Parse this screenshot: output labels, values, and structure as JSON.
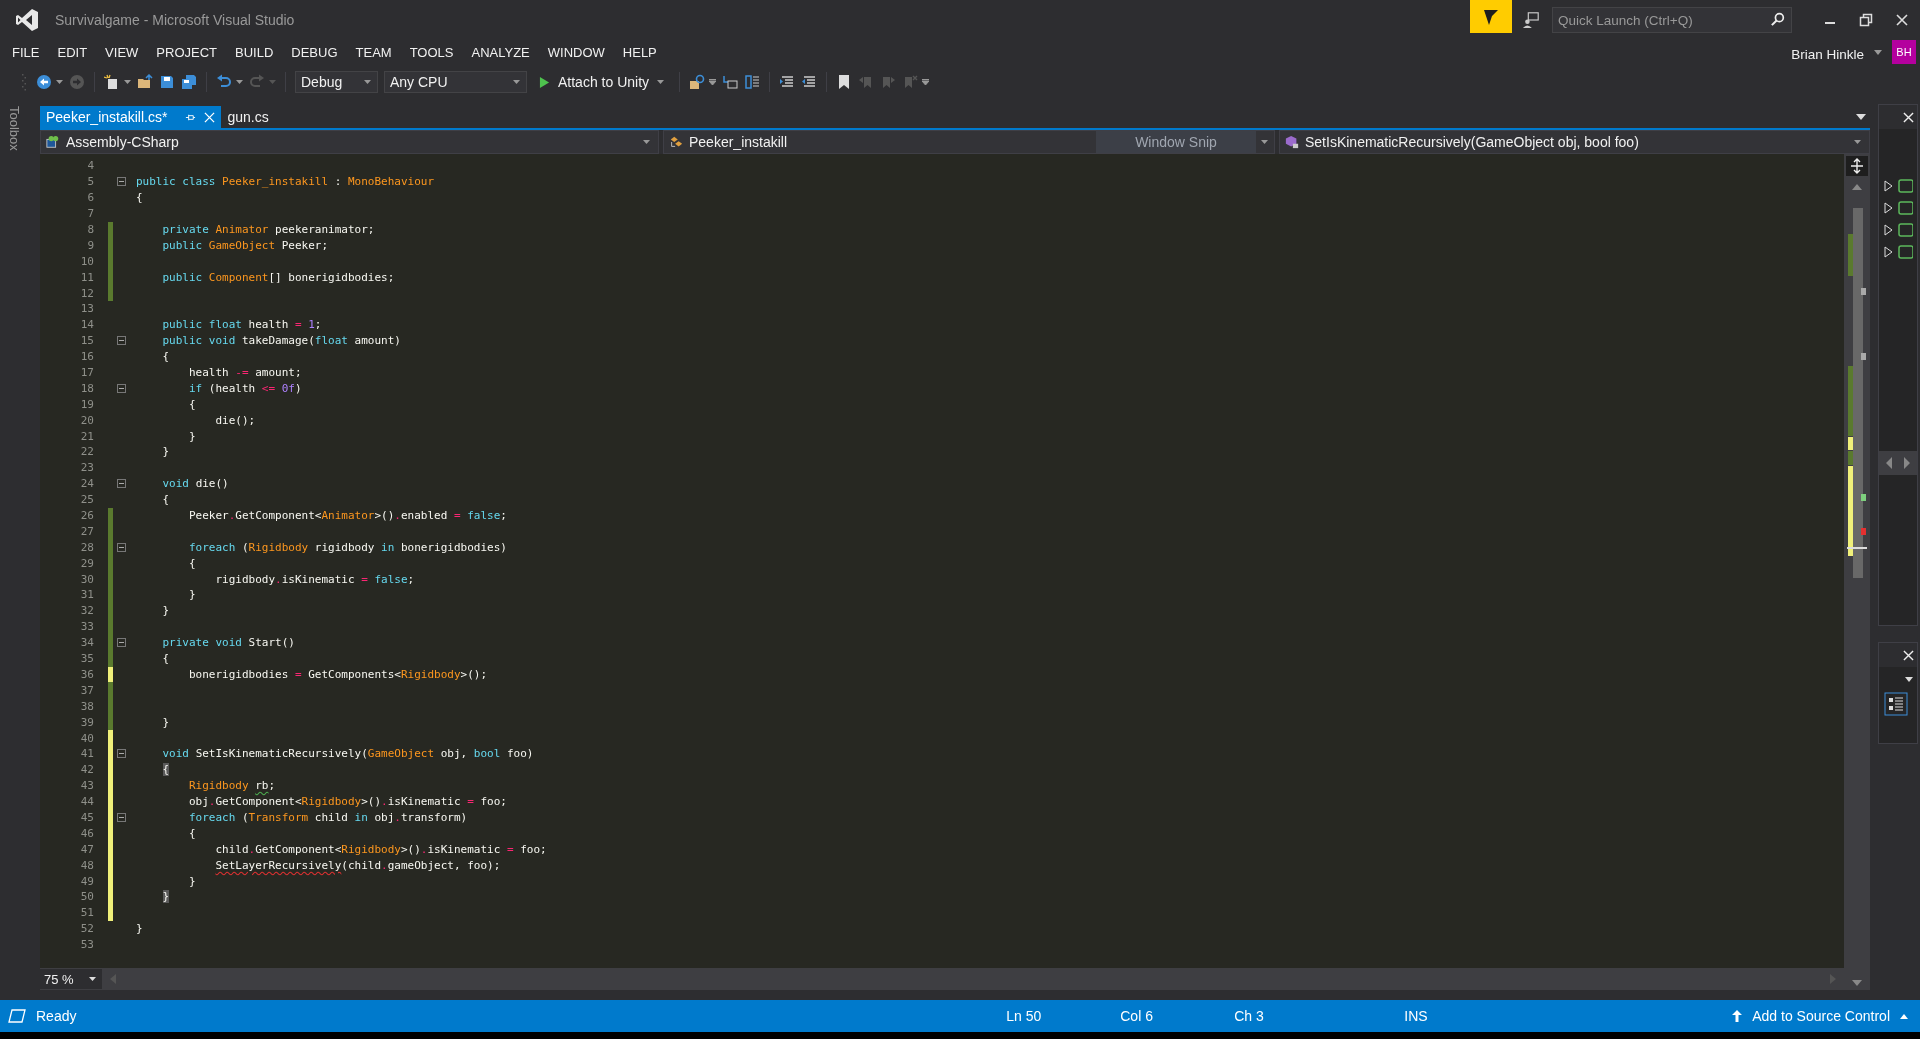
{
  "window": {
    "title": "Survivalgame - Microsoft Visual Studio",
    "quick_launch": {
      "placeholder": "Quick Launch (Ctrl+Q)"
    },
    "user": {
      "name": "Brian Hinkle",
      "initials": "BH"
    }
  },
  "menu": [
    "FILE",
    "EDIT",
    "VIEW",
    "PROJECT",
    "BUILD",
    "DEBUG",
    "TEAM",
    "TOOLS",
    "ANALYZE",
    "WINDOW",
    "HELP"
  ],
  "toolbar": {
    "configuration": "Debug",
    "platform": "Any CPU",
    "run_button": "Attach to Unity"
  },
  "side_tab": "Toolbox",
  "tabs": [
    {
      "label": "Peeker_instakill.cs*",
      "selected": true
    },
    {
      "label": "gun.cs",
      "selected": false
    }
  ],
  "navigation_bar": {
    "project": "Assembly-CSharp",
    "class": "Peeker_instakill",
    "overlay": "Window Snip",
    "member": "SetIsKinematicRecursively(GameObject obj, bool foo)"
  },
  "code_lines": [
    {
      "number": "4"
    },
    {
      "number": "5",
      "fold": true,
      "tokens": [
        {
          "kind": "kw",
          "text": "public class "
        },
        {
          "kind": "type",
          "text": "Peeker_instakill"
        },
        {
          "kind": "plain",
          "text": " : "
        },
        {
          "kind": "type",
          "text": "MonoBehaviour"
        }
      ]
    },
    {
      "number": "6",
      "tokens": [
        {
          "kind": "plain",
          "text": "{"
        }
      ]
    },
    {
      "number": "7"
    },
    {
      "number": "8",
      "color": "#5a7a2e",
      "tokens": [
        {
          "kind": "kw",
          "text": "    private "
        },
        {
          "kind": "type",
          "text": "Animator"
        },
        {
          "kind": "plain",
          "text": " peekeranimator;"
        }
      ]
    },
    {
      "number": "9",
      "color": "#5a7a2e",
      "tokens": [
        {
          "kind": "kw",
          "text": "    public "
        },
        {
          "kind": "type",
          "text": "GameObject"
        },
        {
          "kind": "plain",
          "text": " Peeker;"
        }
      ]
    },
    {
      "number": "10",
      "color": "#5a7a2e"
    },
    {
      "number": "11",
      "color": "#5a7a2e",
      "tokens": [
        {
          "kind": "kw",
          "text": "    public "
        },
        {
          "kind": "type",
          "text": "Component"
        },
        {
          "kind": "plain",
          "text": "[] bonerigidbodies;"
        }
      ]
    },
    {
      "number": "12",
      "color": "#5a7a2e"
    },
    {
      "number": "13"
    },
    {
      "number": "14",
      "tokens": [
        {
          "kind": "kw",
          "text": "    public float"
        },
        {
          "kind": "plain",
          "text": " health "
        },
        {
          "kind": "op",
          "text": "="
        },
        {
          "kind": "num",
          "text": " 1"
        },
        {
          "kind": "plain",
          "text": ";"
        }
      ]
    },
    {
      "number": "15",
      "fold": true,
      "tokens": [
        {
          "kind": "kw",
          "text": "    public void"
        },
        {
          "kind": "plain",
          "text": " takeDamage("
        },
        {
          "kind": "kw",
          "text": "float"
        },
        {
          "kind": "plain",
          "text": " amount)"
        }
      ]
    },
    {
      "number": "16",
      "tokens": [
        {
          "kind": "plain",
          "text": "    {"
        }
      ]
    },
    {
      "number": "17",
      "tokens": [
        {
          "kind": "plain",
          "text": "        health "
        },
        {
          "kind": "op",
          "text": "-="
        },
        {
          "kind": "plain",
          "text": " amount;"
        }
      ]
    },
    {
      "number": "18",
      "fold": true,
      "tokens": [
        {
          "kind": "kw",
          "text": "        if"
        },
        {
          "kind": "plain",
          "text": " (health "
        },
        {
          "kind": "op",
          "text": "<="
        },
        {
          "kind": "num",
          "text": " 0f"
        },
        {
          "kind": "plain",
          "text": ")"
        }
      ]
    },
    {
      "number": "19",
      "tokens": [
        {
          "kind": "plain",
          "text": "        {"
        }
      ]
    },
    {
      "number": "20",
      "tokens": [
        {
          "kind": "plain",
          "text": "            die();"
        }
      ]
    },
    {
      "number": "21",
      "tokens": [
        {
          "kind": "plain",
          "text": "        }"
        }
      ]
    },
    {
      "number": "22",
      "tokens": [
        {
          "kind": "plain",
          "text": "    }"
        }
      ]
    },
    {
      "number": "23"
    },
    {
      "number": "24",
      "fold": true,
      "tokens": [
        {
          "kind": "kw",
          "text": "    void"
        },
        {
          "kind": "plain",
          "text": " die()"
        }
      ]
    },
    {
      "number": "25",
      "tokens": [
        {
          "kind": "plain",
          "text": "    {"
        }
      ]
    },
    {
      "number": "26",
      "color": "#5a7a2e",
      "tokens": [
        {
          "kind": "plain",
          "text": "        Peeker"
        },
        {
          "kind": "op",
          "text": "."
        },
        {
          "kind": "plain",
          "text": "GetComponent<"
        },
        {
          "kind": "type",
          "text": "Animator"
        },
        {
          "kind": "plain",
          "text": ">()"
        },
        {
          "kind": "op",
          "text": "."
        },
        {
          "kind": "plain",
          "text": "enabled "
        },
        {
          "kind": "op",
          "text": "="
        },
        {
          "kind": "kw",
          "text": " false"
        },
        {
          "kind": "plain",
          "text": ";"
        }
      ]
    },
    {
      "number": "27",
      "color": "#5a7a2e"
    },
    {
      "number": "28",
      "color": "#5a7a2e",
      "fold": true,
      "tokens": [
        {
          "kind": "kw",
          "text": "        foreach"
        },
        {
          "kind": "plain",
          "text": " ("
        },
        {
          "kind": "type",
          "text": "Rigidbody"
        },
        {
          "kind": "plain",
          "text": " rigidbody "
        },
        {
          "kind": "kw",
          "text": "in"
        },
        {
          "kind": "plain",
          "text": " bonerigidbodies)"
        }
      ]
    },
    {
      "number": "29",
      "color": "#5a7a2e",
      "tokens": [
        {
          "kind": "plain",
          "text": "        {"
        }
      ]
    },
    {
      "number": "30",
      "color": "#5a7a2e",
      "tokens": [
        {
          "kind": "plain",
          "text": "            rigidbody"
        },
        {
          "kind": "op",
          "text": "."
        },
        {
          "kind": "plain",
          "text": "isKinematic "
        },
        {
          "kind": "op",
          "text": "="
        },
        {
          "kind": "kw",
          "text": " false"
        },
        {
          "kind": "plain",
          "text": ";"
        }
      ]
    },
    {
      "number": "31",
      "color": "#5a7a2e",
      "tokens": [
        {
          "kind": "plain",
          "text": "        }"
        }
      ]
    },
    {
      "number": "32",
      "color": "#5a7a2e",
      "tokens": [
        {
          "kind": "plain",
          "text": "    }"
        }
      ]
    },
    {
      "number": "33",
      "color": "#5a7a2e"
    },
    {
      "number": "34",
      "color": "#5a7a2e",
      "fold": true,
      "tokens": [
        {
          "kind": "kw",
          "text": "    private void"
        },
        {
          "kind": "plain",
          "text": " Start()"
        }
      ]
    },
    {
      "number": "35",
      "color": "#5a7a2e",
      "tokens": [
        {
          "kind": "plain",
          "text": "    {"
        }
      ]
    },
    {
      "number": "36",
      "color": "#f0f07a",
      "tokens": [
        {
          "kind": "plain",
          "text": "        bonerigidbodies "
        },
        {
          "kind": "op",
          "text": "="
        },
        {
          "kind": "plain",
          "text": " GetComponents<"
        },
        {
          "kind": "type",
          "text": "Rigidbody"
        },
        {
          "kind": "plain",
          "text": ">();"
        }
      ]
    },
    {
      "number": "37",
      "color": "#5a7a2e"
    },
    {
      "number": "38",
      "color": "#5a7a2e"
    },
    {
      "number": "39",
      "color": "#5a7a2e",
      "tokens": [
        {
          "kind": "plain",
          "text": "    }"
        }
      ]
    },
    {
      "number": "40",
      "color": "#f0f07a"
    },
    {
      "number": "41",
      "color": "#f0f07a",
      "fold": true,
      "tokens": [
        {
          "kind": "kw",
          "text": "    void"
        },
        {
          "kind": "plain",
          "text": " SetIsKinematicRecursively("
        },
        {
          "kind": "type",
          "text": "GameObject"
        },
        {
          "kind": "plain",
          "text": " obj, "
        },
        {
          "kind": "kw",
          "text": "bool"
        },
        {
          "kind": "plain",
          "text": " foo)"
        }
      ]
    },
    {
      "number": "42",
      "color": "#f0f07a",
      "tokens": [
        {
          "kind": "plain",
          "text": "    {",
          "highlighted": true
        }
      ]
    },
    {
      "number": "43",
      "color": "#f0f07a",
      "tokens": [
        {
          "kind": "type",
          "text": "        Rigidbody"
        },
        {
          "kind": "plain",
          "text": " rb",
          "warning": true
        },
        {
          "kind": "plain",
          "text": ";"
        }
      ]
    },
    {
      "number": "44",
      "color": "#f0f07a",
      "tokens": [
        {
          "kind": "plain",
          "text": "        obj"
        },
        {
          "kind": "op",
          "text": "."
        },
        {
          "kind": "plain",
          "text": "GetComponent<"
        },
        {
          "kind": "type",
          "text": "Rigidbody"
        },
        {
          "kind": "plain",
          "text": ">()"
        },
        {
          "kind": "op",
          "text": "."
        },
        {
          "kind": "plain",
          "text": "isKinematic "
        },
        {
          "kind": "op",
          "text": "="
        },
        {
          "kind": "plain",
          "text": " foo;"
        }
      ]
    },
    {
      "number": "45",
      "color": "#f0f07a",
      "fold": true,
      "tokens": [
        {
          "kind": "kw",
          "text": "        foreach"
        },
        {
          "kind": "plain",
          "text": " ("
        },
        {
          "kind": "type",
          "text": "Transform"
        },
        {
          "kind": "plain",
          "text": " child "
        },
        {
          "kind": "kw",
          "text": "in"
        },
        {
          "kind": "plain",
          "text": " obj"
        },
        {
          "kind": "op",
          "text": "."
        },
        {
          "kind": "plain",
          "text": "transform)"
        }
      ]
    },
    {
      "number": "46",
      "color": "#f0f07a",
      "tokens": [
        {
          "kind": "plain",
          "text": "        {"
        }
      ]
    },
    {
      "number": "47",
      "color": "#f0f07a",
      "tokens": [
        {
          "kind": "plain",
          "text": "            child"
        },
        {
          "kind": "op",
          "text": "."
        },
        {
          "kind": "plain",
          "text": "GetComponent<"
        },
        {
          "kind": "type",
          "text": "Rigidbody"
        },
        {
          "kind": "plain",
          "text": ">()"
        },
        {
          "kind": "op",
          "text": "."
        },
        {
          "kind": "plain",
          "text": "isKinematic "
        },
        {
          "kind": "op",
          "text": "="
        },
        {
          "kind": "plain",
          "text": " foo;"
        }
      ]
    },
    {
      "number": "48",
      "color": "#f0f07a",
      "tokens": [
        {
          "kind": "plain",
          "text": "            SetLayerRecursively",
          "error": true
        },
        {
          "kind": "plain",
          "text": "(child"
        },
        {
          "kind": "op",
          "text": "."
        },
        {
          "kind": "plain",
          "text": "gameObject, foo);"
        }
      ]
    },
    {
      "number": "49",
      "color": "#f0f07a",
      "tokens": [
        {
          "kind": "plain",
          "text": "        }"
        }
      ]
    },
    {
      "number": "50",
      "color": "#f0f07a",
      "tokens": [
        {
          "kind": "plain",
          "text": "    }",
          "highlighted": true
        }
      ]
    },
    {
      "number": "51",
      "color": "#f0f07a"
    },
    {
      "number": "52",
      "tokens": [
        {
          "kind": "plain",
          "text": "}"
        }
      ]
    },
    {
      "number": "53"
    }
  ],
  "zoom": "75 %",
  "status_bar": {
    "message": "Ready",
    "line": "Ln 50",
    "column": "Col 6",
    "char": "Ch 3",
    "mode": "INS",
    "source_control": "Add to Source Control"
  }
}
